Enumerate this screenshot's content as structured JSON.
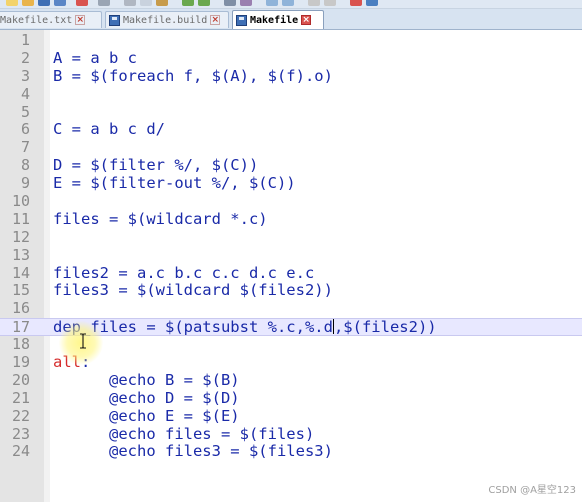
{
  "tabs": [
    {
      "label": "Makefile.txt",
      "icon": "disk-icon",
      "active": false
    },
    {
      "label": "Makefile.build",
      "icon": "disk-icon",
      "active": false
    },
    {
      "label": "Makefile",
      "icon": "disk-icon",
      "active": true
    }
  ],
  "tab_close_symbol": "×",
  "editor": {
    "current_line": 17,
    "lines": [
      {
        "n": "1",
        "text": ""
      },
      {
        "n": "2",
        "text": "A = a b c"
      },
      {
        "n": "3",
        "text": "B = $(foreach f, $(A), $(f).o)"
      },
      {
        "n": "4",
        "text": ""
      },
      {
        "n": "5",
        "text": ""
      },
      {
        "n": "6",
        "text": "C = a b c d/"
      },
      {
        "n": "7",
        "text": ""
      },
      {
        "n": "8",
        "text": "D = $(filter %/, $(C))"
      },
      {
        "n": "9",
        "text": "E = $(filter-out %/, $(C))"
      },
      {
        "n": "10",
        "text": ""
      },
      {
        "n": "11",
        "text": "files = $(wildcard *.c)"
      },
      {
        "n": "12",
        "text": ""
      },
      {
        "n": "13",
        "text": ""
      },
      {
        "n": "14",
        "text": "files2 = a.c b.c c.c d.c e.c"
      },
      {
        "n": "15",
        "text": "files3 = $(wildcard $(files2))"
      },
      {
        "n": "16",
        "text": ""
      },
      {
        "n": "17",
        "text_before_caret": "dep_files = $(patsubst %.c,%.d",
        "text_after_caret": ",$(files2))"
      },
      {
        "n": "18",
        "text": ""
      },
      {
        "n": "19",
        "keyword": "all",
        "text": ":"
      },
      {
        "n": "20",
        "text": "      @echo B = $(B)"
      },
      {
        "n": "21",
        "text": "      @echo D = $(D)"
      },
      {
        "n": "22",
        "text": "      @echo E = $(E)"
      },
      {
        "n": "23",
        "text": "      @echo files = $(files)"
      },
      {
        "n": "24",
        "text": "      @echo files3 = $(files3)"
      }
    ]
  },
  "watermark": "CSDN @A星空123",
  "colors": {
    "code_text": "#1a2aa8",
    "keyword": "#d62d2d",
    "line_number": "#8a8a8a",
    "gutter": "#e4e4e4",
    "current_line": "#e8e8ff",
    "active_tab_close": "#d9534f",
    "tabbar": "#d7e3f1"
  }
}
